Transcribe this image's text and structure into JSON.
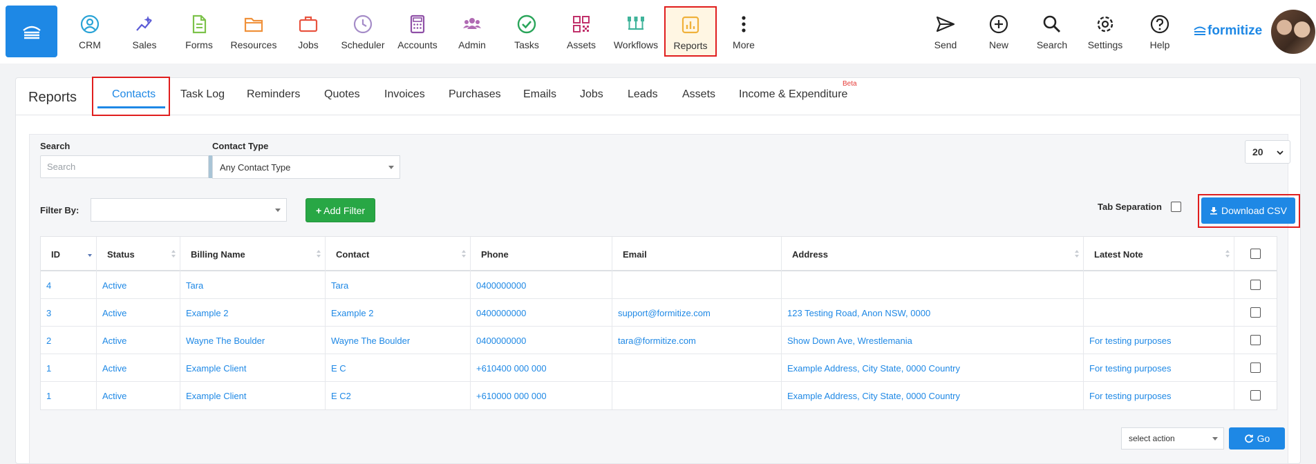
{
  "nav": {
    "items": [
      {
        "label": "CRM",
        "icon": "user-circle-icon",
        "color": "#29a3d6"
      },
      {
        "label": "Sales",
        "icon": "sparkle-chart-icon",
        "color": "#5b5bd6"
      },
      {
        "label": "Forms",
        "icon": "document-icon",
        "color": "#7cc24a"
      },
      {
        "label": "Resources",
        "icon": "folder-icon",
        "color": "#f0913a"
      },
      {
        "label": "Jobs",
        "icon": "briefcase-icon",
        "color": "#e8533f"
      },
      {
        "label": "Scheduler",
        "icon": "clock-icon",
        "color": "#a58cc8"
      },
      {
        "label": "Accounts",
        "icon": "calculator-icon",
        "color": "#8e4fa6"
      },
      {
        "label": "Admin",
        "icon": "users-icon",
        "color": "#b06ab3"
      },
      {
        "label": "Tasks",
        "icon": "check-circle-icon",
        "color": "#2aa55a"
      },
      {
        "label": "Assets",
        "icon": "qr-code-icon",
        "color": "#c0306a"
      },
      {
        "label": "Workflows",
        "icon": "workflow-icon",
        "color": "#3fb39a"
      },
      {
        "label": "Reports",
        "icon": "bar-chart-icon",
        "color": "#f0b13a"
      },
      {
        "label": "More",
        "icon": "vertical-dots-icon",
        "color": "#222222"
      }
    ],
    "right_items": [
      {
        "label": "Send",
        "icon": "send-icon"
      },
      {
        "label": "New",
        "icon": "plus-circle-icon"
      },
      {
        "label": "Search",
        "icon": "search-icon"
      },
      {
        "label": "Settings",
        "icon": "gear-icon"
      },
      {
        "label": "Help",
        "icon": "help-circle-icon"
      }
    ],
    "brand": "formitize",
    "accent": "#1e88e5"
  },
  "page": {
    "title": "Reports",
    "tabs": [
      "Contacts",
      "Task Log",
      "Reminders",
      "Quotes",
      "Invoices",
      "Purchases",
      "Emails",
      "Jobs",
      "Leads",
      "Assets",
      "Income & Expenditure"
    ],
    "active_tab": "Contacts",
    "beta_label": "Beta"
  },
  "filters": {
    "search_label": "Search",
    "search_placeholder": "Search",
    "contact_type_label": "Contact Type",
    "contact_type_value": "Any Contact Type",
    "per_page": "20",
    "filter_by_label": "Filter By:",
    "add_filter_label": "Add Filter",
    "tab_separation_label": "Tab Separation",
    "download_label": "Download CSV"
  },
  "table": {
    "columns": [
      "ID",
      "Status",
      "Billing Name",
      "Contact",
      "Phone",
      "Email",
      "Address",
      "Latest Note"
    ],
    "rows": [
      [
        "4",
        "Active",
        "Tara",
        "Tara",
        "0400000000",
        "",
        "",
        ""
      ],
      [
        "3",
        "Active",
        "Example 2",
        "Example 2",
        "0400000000",
        "support@formitize.com",
        "123 Testing Road, Anon NSW, 0000",
        ""
      ],
      [
        "2",
        "Active",
        "Wayne The Boulder",
        "Wayne The Boulder",
        "0400000000",
        "tara@formitize.com",
        "Show Down Ave, Wrestlemania",
        "For testing purposes"
      ],
      [
        "1",
        "Active",
        "Example Client",
        "E C",
        "+610400 000 000",
        "",
        "Example Address, City State, 0000 Country",
        "For testing purposes"
      ],
      [
        "1",
        "Active",
        "Example Client",
        "E C2",
        "+610000 000 000",
        "",
        "Example Address, City State, 0000 Country",
        "For testing purposes"
      ]
    ]
  },
  "bulk": {
    "action_placeholder": "select action",
    "go_label": "Go"
  }
}
